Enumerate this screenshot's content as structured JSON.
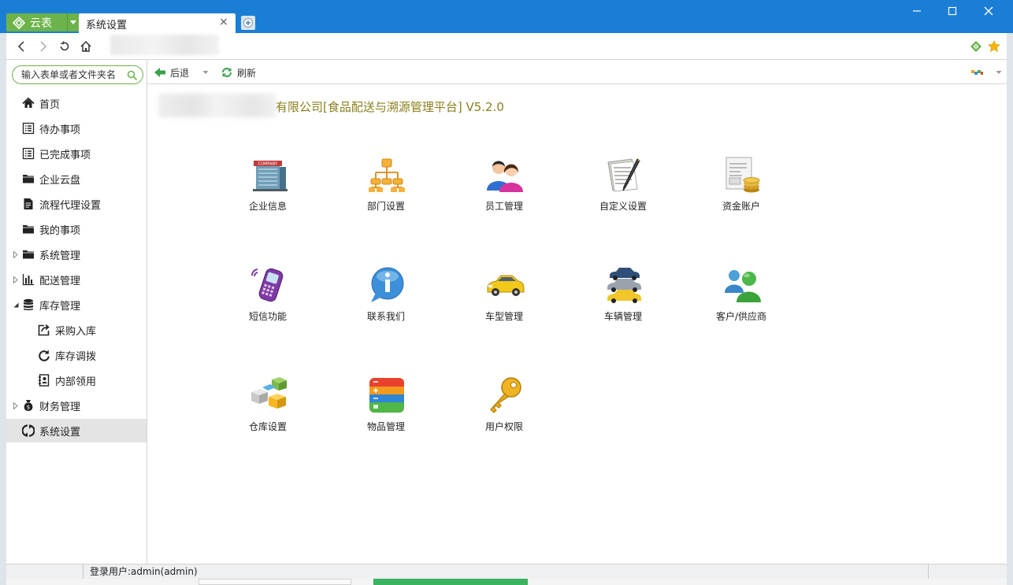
{
  "titlebar": {
    "app_name": "云表",
    "tab_label": "系统设置",
    "tab_close": "×",
    "colors": {
      "bar": "#1a7fd4",
      "app_button": "#6bb34a"
    }
  },
  "toolbar": {
    "back_label": "后退",
    "refresh_label": "刷新"
  },
  "sidebar": {
    "search_placeholder": "输入表单或者文件夹名",
    "items": [
      {
        "label": "首页",
        "icon": "home-icon"
      },
      {
        "label": "待办事项",
        "icon": "list-icon"
      },
      {
        "label": "已完成事项",
        "icon": "list-icon"
      },
      {
        "label": "企业云盘",
        "icon": "folder-icon"
      },
      {
        "label": "流程代理设置",
        "icon": "doc-icon"
      },
      {
        "label": "我的事项",
        "icon": "folder-icon"
      },
      {
        "label": "系统管理",
        "icon": "folder-icon"
      },
      {
        "label": "配送管理",
        "icon": "bar-chart-icon"
      },
      {
        "label": "库存管理",
        "icon": "database-icon"
      },
      {
        "label": "采购入库",
        "icon": "export-icon"
      },
      {
        "label": "库存调拨",
        "icon": "refresh-icon"
      },
      {
        "label": "内部领用",
        "icon": "contacts-icon"
      },
      {
        "label": "财务管理",
        "icon": "money-bag-icon"
      },
      {
        "label": "系统设置",
        "icon": "settings-icon"
      }
    ]
  },
  "main": {
    "title": "有限公司[食品配送与溯源管理平台] V5.2.0",
    "tiles": [
      {
        "label": "企业信息",
        "icon": "company-building-icon"
      },
      {
        "label": "部门设置",
        "icon": "org-chart-icon"
      },
      {
        "label": "员工管理",
        "icon": "users-icon"
      },
      {
        "label": "自定义设置",
        "icon": "notepad-pen-icon"
      },
      {
        "label": "资金账户",
        "icon": "coins-document-icon"
      },
      {
        "label": "短信功能",
        "icon": "mobile-phone-icon"
      },
      {
        "label": "联系我们",
        "icon": "info-bubble-icon"
      },
      {
        "label": "车型管理",
        "icon": "car-icon"
      },
      {
        "label": "车辆管理",
        "icon": "cars-stack-icon"
      },
      {
        "label": "客户/供应商",
        "icon": "contacts-people-icon"
      },
      {
        "label": "仓库设置",
        "icon": "warehouse-boxes-icon"
      },
      {
        "label": "物品管理",
        "icon": "item-list-icon"
      },
      {
        "label": "用户权限",
        "icon": "key-icon"
      }
    ]
  },
  "status": {
    "user": "登录用户:admin(admin)"
  }
}
